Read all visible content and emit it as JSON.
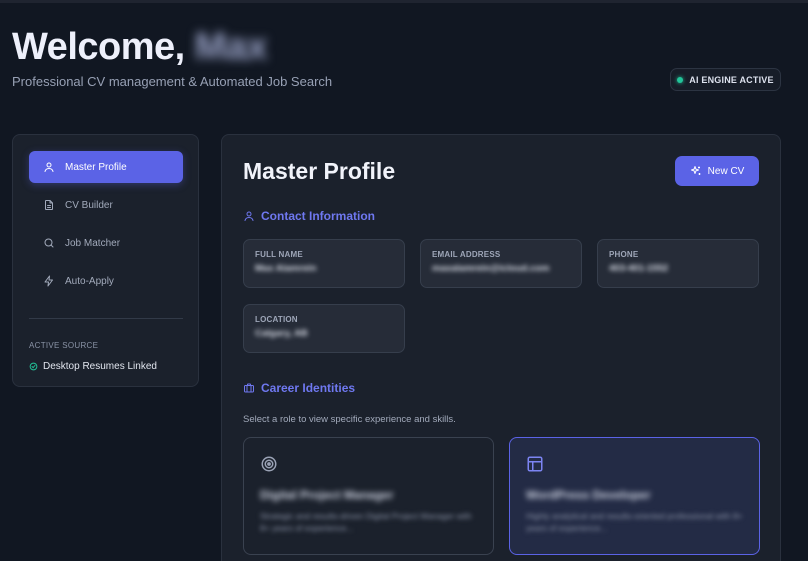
{
  "header": {
    "welcome_prefix": "Welcome,",
    "user_name": "Max",
    "subtitle": "Professional CV management & Automated Job Search",
    "ai_badge": "AI ENGINE ACTIVE"
  },
  "sidebar": {
    "items": [
      {
        "label": "Master Profile",
        "icon": "user-icon",
        "active": true
      },
      {
        "label": "CV Builder",
        "icon": "document-icon",
        "active": false
      },
      {
        "label": "Job Matcher",
        "icon": "search-icon",
        "active": false
      },
      {
        "label": "Auto-Apply",
        "icon": "lightning-icon",
        "active": false
      }
    ],
    "source_label": "ACTIVE SOURCE",
    "source_value": "Desktop Resumes Linked"
  },
  "main": {
    "title": "Master Profile",
    "new_cv_label": "New CV",
    "contact": {
      "heading": "Contact Information",
      "fields": [
        {
          "label": "FULL NAME",
          "value": "Max Alamrein"
        },
        {
          "label": "EMAIL ADDRESS",
          "value": "maxalamrein@icloud.com"
        },
        {
          "label": "PHONE",
          "value": "403-401-1552"
        },
        {
          "label": "LOCATION",
          "value": "Calgary, AB"
        }
      ]
    },
    "career": {
      "heading": "Career Identities",
      "hint": "Select a role to view specific experience and skills.",
      "roles": [
        {
          "title": "Digital Project Manager",
          "description": "Strategic and results-driven Digital Project Manager with 8+ years of experience...",
          "icon": "target-icon",
          "selected": false
        },
        {
          "title": "WordPress Developer",
          "description": "Highly analytical and results-oriented professional with 8+ years of experience...",
          "icon": "layout-icon",
          "selected": true
        }
      ]
    }
  },
  "colors": {
    "accent": "#5b63e6",
    "accent_text": "#6f78f0",
    "background": "#111722",
    "panel": "#1b212c",
    "status_green": "#22c59a"
  }
}
